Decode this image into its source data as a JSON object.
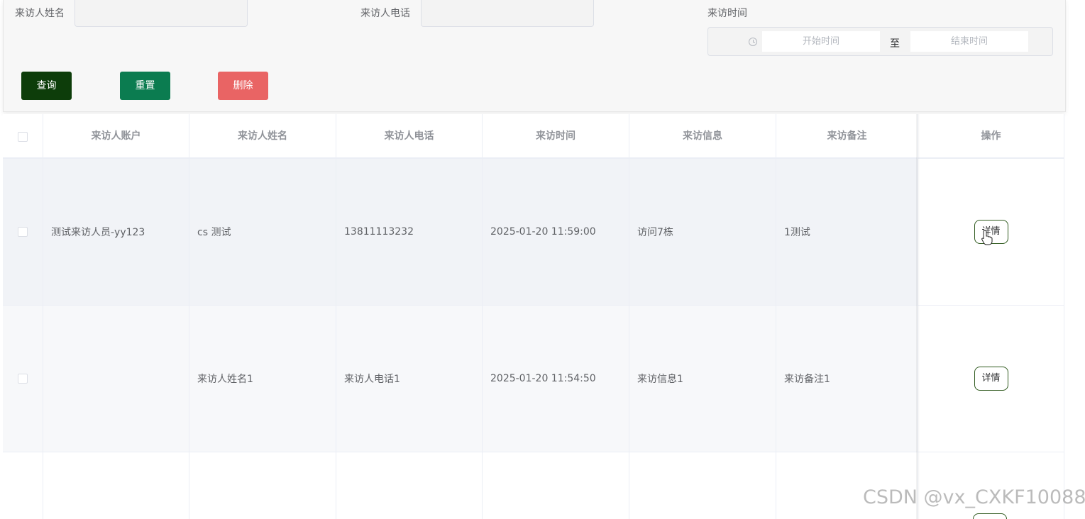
{
  "search": {
    "name_label": "来访人姓名",
    "name_value": "",
    "phone_label": "来访人电话",
    "phone_value": "",
    "time_label": "来访时间",
    "start_placeholder": "开始时间",
    "range_separator": "至",
    "end_placeholder": "结束时间"
  },
  "buttons": {
    "query": "查询",
    "reset": "重置",
    "delete": "删除"
  },
  "table": {
    "headers": [
      "来访人账户",
      "来访人姓名",
      "来访人电话",
      "来访时间",
      "来访信息",
      "来访备注",
      "操作"
    ],
    "rows": [
      {
        "account": "测试来访人员-yy123",
        "name": "cs 测试",
        "phone": "13811113232",
        "time": "2025-01-20 11:59:00",
        "info": "访问7栋",
        "remark": "1测试",
        "action": "详情"
      },
      {
        "account": "",
        "name": "来访人姓名1",
        "phone": "来访人电话1",
        "time": "2025-01-20 11:54:50",
        "info": "来访信息1",
        "remark": "来访备注1",
        "action": "详情"
      },
      {
        "account": "",
        "name": "",
        "phone": "",
        "time": "",
        "info": "",
        "remark": "",
        "action": ""
      }
    ]
  },
  "watermark": "CSDN @vx_CXKF10088",
  "colors": {
    "query_button": "#0d3d0a",
    "reset_button": "#0b7c50",
    "delete_button": "#e96464"
  }
}
